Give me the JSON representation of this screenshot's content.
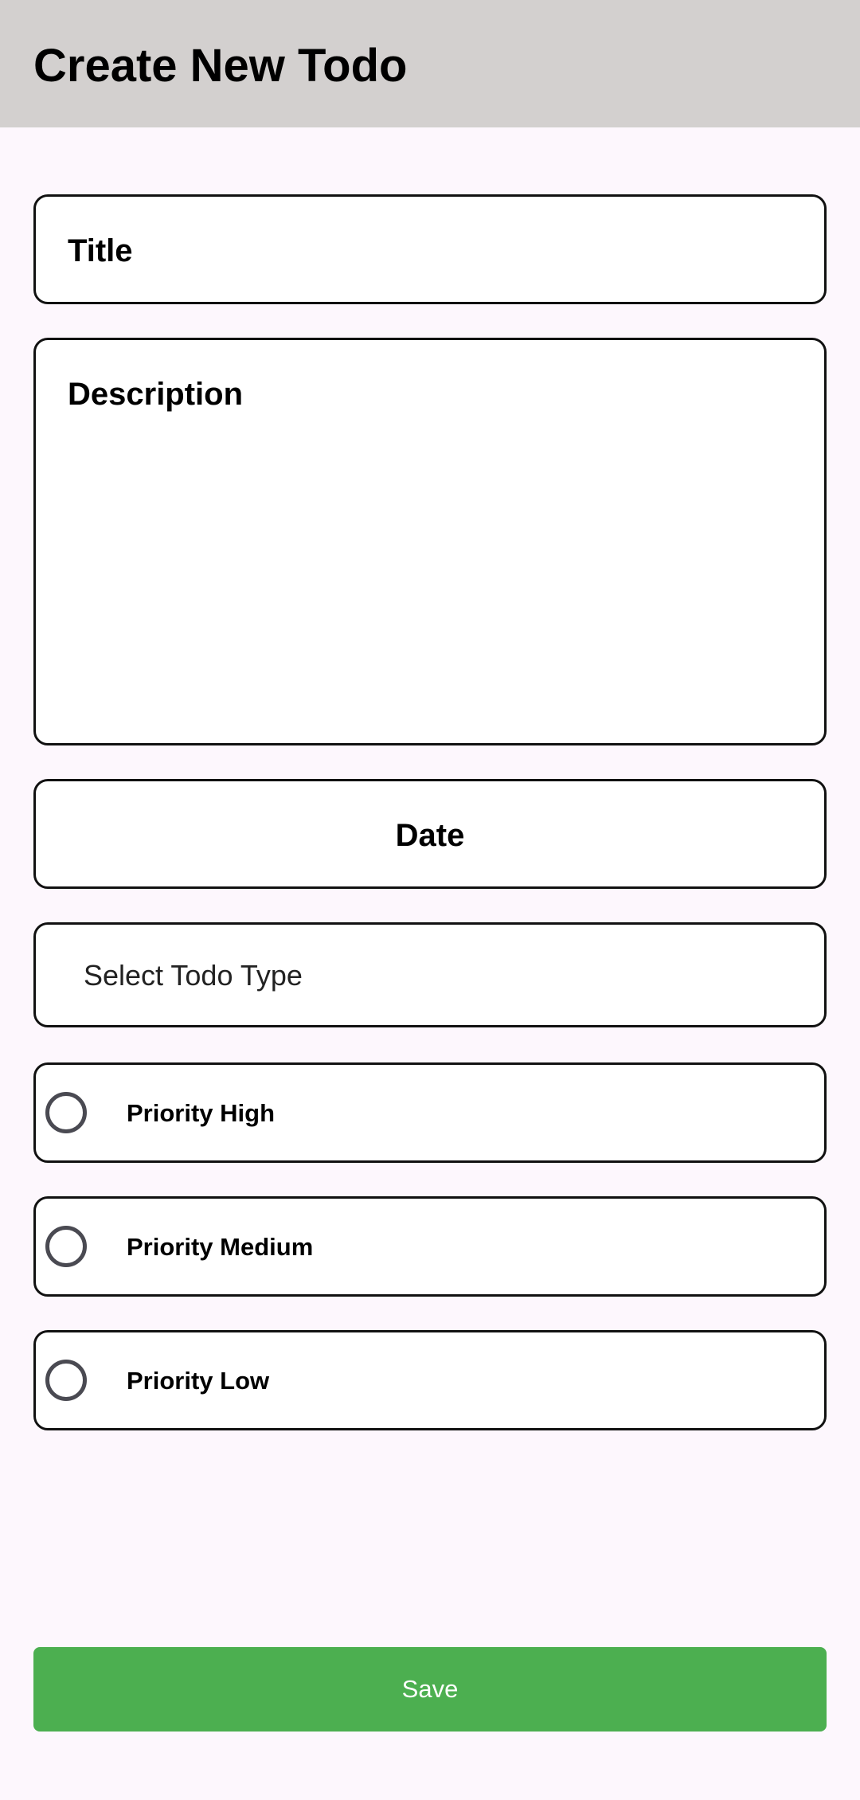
{
  "header": {
    "title": "Create New Todo"
  },
  "form": {
    "title_placeholder": "Title",
    "description_placeholder": "Description",
    "date_label": "Date",
    "type_select": {
      "selected": "Select Todo Type"
    },
    "priorities": [
      {
        "label": "Priority High",
        "selected": false
      },
      {
        "label": "Priority Medium",
        "selected": false
      },
      {
        "label": "Priority Low",
        "selected": false
      }
    ],
    "save_label": "Save"
  },
  "colors": {
    "app_bar": "#d3d0cf",
    "background": "#fdf7fd",
    "save_button": "#4caf50",
    "radio_border": "#4a4a52"
  }
}
